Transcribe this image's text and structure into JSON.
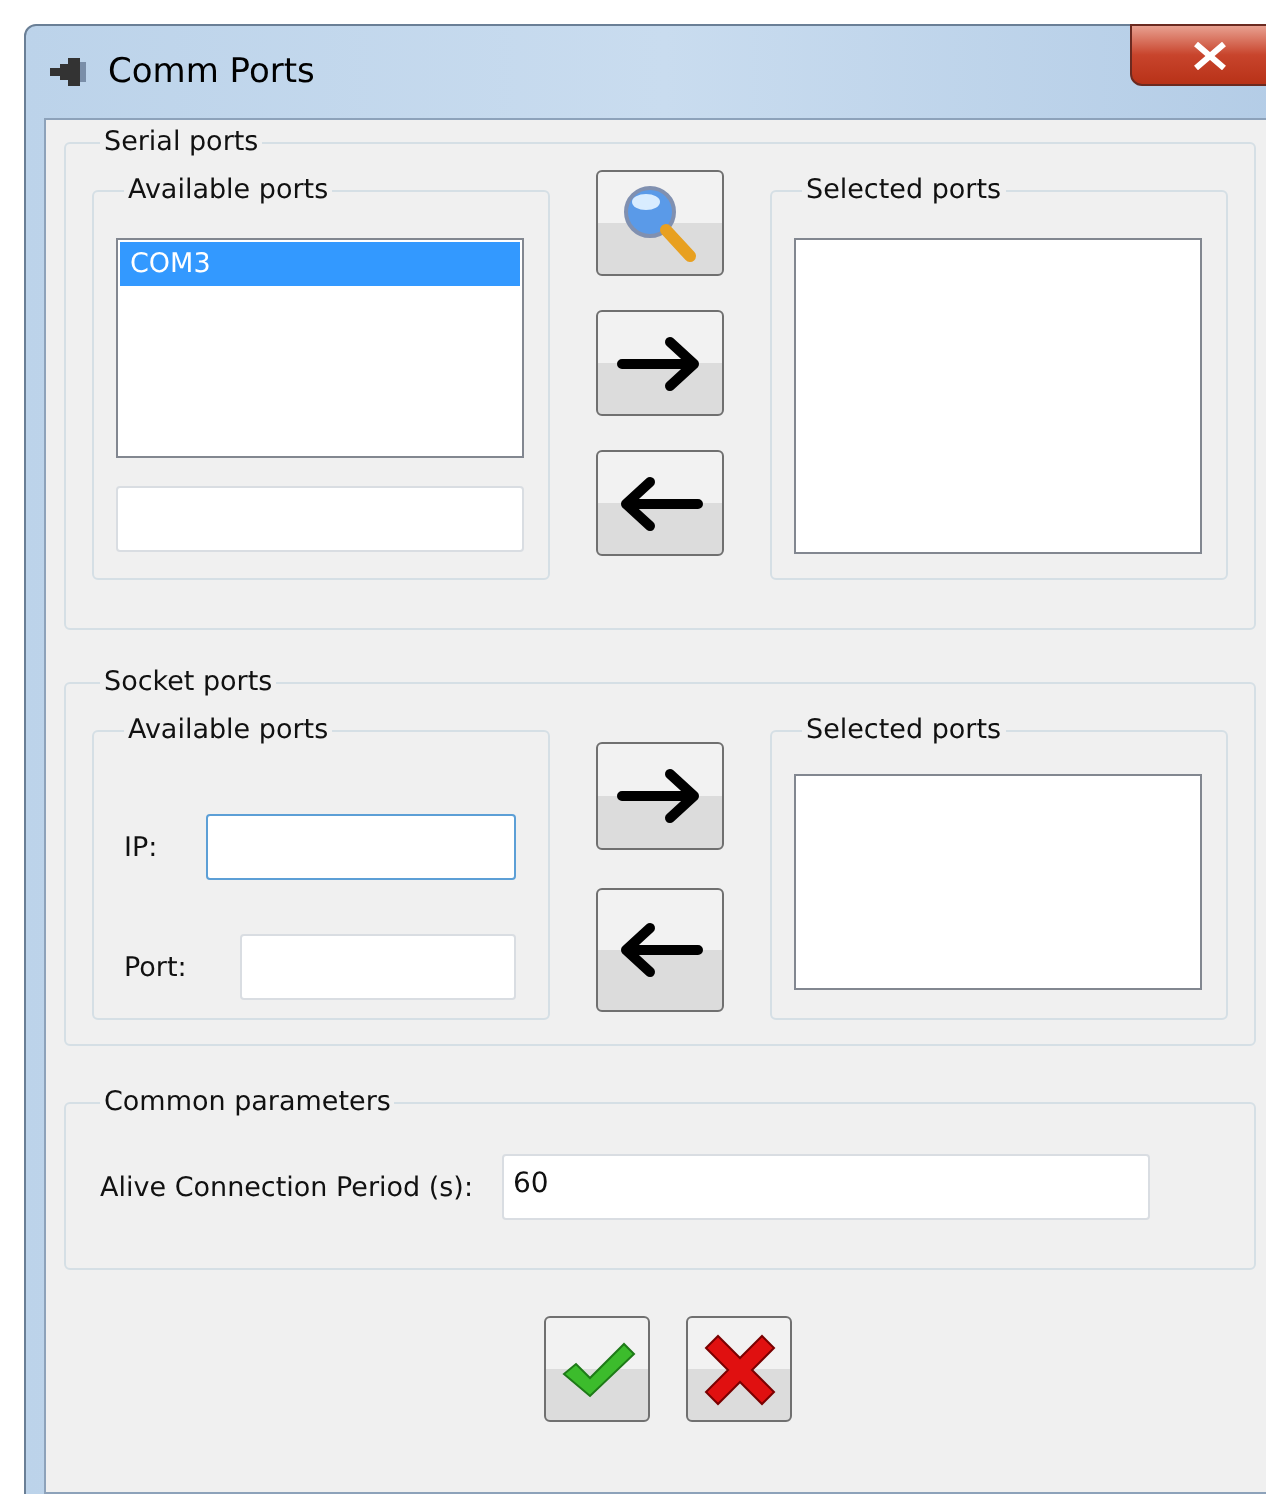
{
  "window": {
    "title": "Comm Ports"
  },
  "serial_ports": {
    "title": "Serial ports",
    "available": {
      "title": "Available ports",
      "items": [
        {
          "label": "COM3",
          "selected": true
        }
      ]
    },
    "buttons": [
      {
        "kind": "search"
      },
      {
        "kind": "add"
      },
      {
        "kind": "remove"
      }
    ],
    "selected": {
      "title": "Selected ports"
    }
  },
  "socket_ports": {
    "title": "Socket ports",
    "available": {
      "title": "Available ports",
      "fields": [
        {
          "label": "IP:",
          "focused": true
        },
        {
          "label": "Port:",
          "focused": false
        }
      ]
    },
    "buttons": [
      {
        "kind": "add"
      },
      {
        "kind": "remove"
      }
    ],
    "selected": {
      "title": "Selected ports"
    }
  },
  "common_parameters": {
    "title": "Common parameters",
    "fields": [
      {
        "label": "Alive Connection Period (s):",
        "value": "60"
      }
    ]
  },
  "buttons": [
    {
      "kind": "ok"
    },
    {
      "kind": "cancel"
    }
  ]
}
